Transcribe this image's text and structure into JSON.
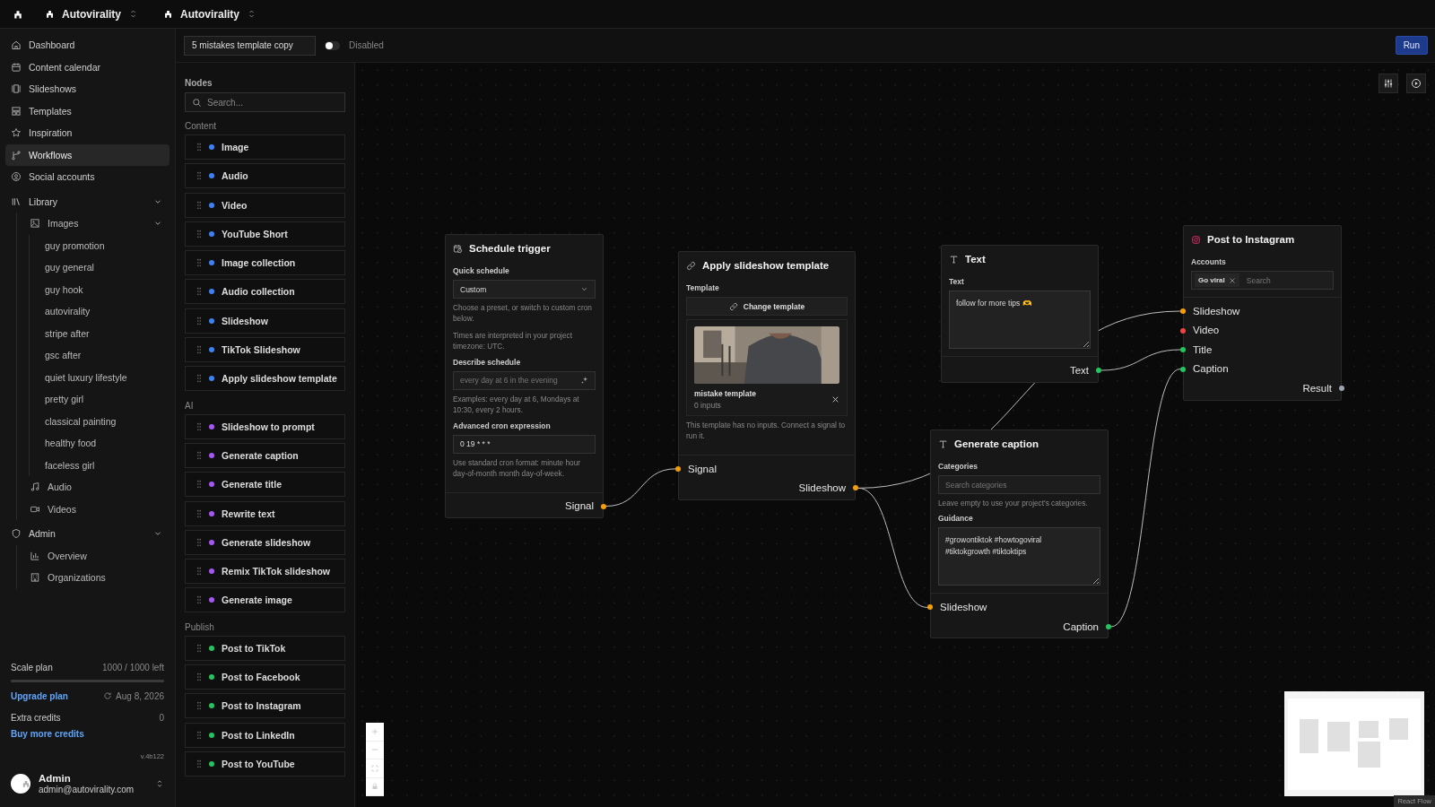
{
  "topbar": {
    "breadcrumbs": [
      {
        "label": "Autovirality"
      },
      {
        "label": "Autovirality"
      }
    ]
  },
  "sidebar": {
    "items": [
      {
        "label": "Dashboard",
        "selected": false
      },
      {
        "label": "Content calendar",
        "selected": false
      },
      {
        "label": "Slideshows",
        "selected": false
      },
      {
        "label": "Templates",
        "selected": false
      },
      {
        "label": "Inspiration",
        "selected": false
      },
      {
        "label": "Workflows",
        "selected": true
      },
      {
        "label": "Social accounts",
        "selected": false
      },
      {
        "label": "Library",
        "selected": false,
        "expanded": true,
        "children": [
          {
            "label": "Images",
            "selected": false,
            "expanded": true,
            "children": [
              {
                "label": "guy promotion",
                "selected": false
              },
              {
                "label": "guy general",
                "selected": false
              },
              {
                "label": "guy hook",
                "selected": false
              },
              {
                "label": "autovirality",
                "selected": false
              },
              {
                "label": "stripe after",
                "selected": false
              },
              {
                "label": "gsc after",
                "selected": false
              },
              {
                "label": "quiet luxury lifestyle",
                "selected": false
              },
              {
                "label": "pretty girl",
                "selected": false
              },
              {
                "label": "classical painting",
                "selected": false
              },
              {
                "label": "healthy food",
                "selected": false
              },
              {
                "label": "faceless girl",
                "selected": false
              }
            ]
          },
          {
            "label": "Audio",
            "selected": false
          },
          {
            "label": "Videos",
            "selected": false
          }
        ]
      },
      {
        "label": "Admin",
        "selected": false,
        "expanded": true,
        "children": [
          {
            "label": "Overview",
            "selected": false
          },
          {
            "label": "Organizations",
            "selected": false
          }
        ]
      }
    ],
    "plan": {
      "name": "Scale plan",
      "credits": "1000 / 1000 left",
      "level": 1,
      "upgrade_link": "Upgrade plan",
      "renewal": "Aug 8, 2026",
      "extra_label": "Extra credits",
      "extra_value": "0",
      "buy_link": "Buy more credits"
    },
    "version": "v.4b122",
    "user": {
      "name": "Admin",
      "email": "admin@autovirality.com"
    }
  },
  "toolbar": {
    "workflow_name": "5 mistakes template copy",
    "enabled": false,
    "toggle_label": "Disabled",
    "run_button": "Run"
  },
  "node_library": {
    "title": "Nodes",
    "search": {
      "placeholder": "Search..."
    },
    "sections": [
      {
        "title": "Content",
        "items": [
          {
            "label": "Image",
            "color": "#3b82f6"
          },
          {
            "label": "Audio",
            "color": "#3b82f6"
          },
          {
            "label": "Video",
            "color": "#3b82f6"
          },
          {
            "label": "YouTube Short",
            "color": "#3b82f6"
          },
          {
            "label": "Image collection",
            "color": "#3b82f6"
          },
          {
            "label": "Audio collection",
            "color": "#3b82f6"
          },
          {
            "label": "Slideshow",
            "color": "#3b82f6"
          },
          {
            "label": "TikTok Slideshow",
            "color": "#3b82f6"
          },
          {
            "label": "Apply slideshow template",
            "color": "#3b82f6"
          }
        ]
      },
      {
        "title": "AI",
        "items": [
          {
            "label": "Slideshow to prompt",
            "color": "#a855f7"
          },
          {
            "label": "Generate caption",
            "color": "#a855f7"
          },
          {
            "label": "Generate title",
            "color": "#a855f7"
          },
          {
            "label": "Rewrite text",
            "color": "#a855f7"
          },
          {
            "label": "Generate slideshow",
            "color": "#a855f7"
          },
          {
            "label": "Remix TikTok slideshow",
            "color": "#a855f7"
          },
          {
            "label": "Generate image",
            "color": "#a855f7"
          }
        ]
      },
      {
        "title": "Publish",
        "items": [
          {
            "label": "Post to TikTok",
            "color": "#22c55e"
          },
          {
            "label": "Post to Facebook",
            "color": "#22c55e"
          },
          {
            "label": "Post to Instagram",
            "color": "#22c55e"
          },
          {
            "label": "Post to LinkedIn",
            "color": "#22c55e"
          },
          {
            "label": "Post to YouTube",
            "color": "#22c55e"
          }
        ]
      }
    ]
  },
  "canvas": {
    "nodes": [
      {
        "kind": "trigger",
        "title": "Schedule trigger",
        "fields": [
          {
            "kind": "select",
            "label": "Quick schedule",
            "value": "Custom"
          },
          {
            "kind": "note",
            "text": "Choose a preset, or switch to custom cron below."
          },
          {
            "kind": "note",
            "text": "Times are interpreted in your project timezone: UTC."
          },
          {
            "kind": "prompt-input",
            "label": "Describe schedule",
            "placeholder": "every day at 6 in the evening"
          },
          {
            "kind": "note",
            "text": "Examples: every day at 6, Mondays at 10:30, every 2 hours."
          },
          {
            "kind": "input",
            "label": "Advanced cron expression",
            "value": "0 19 * * *"
          },
          {
            "kind": "note",
            "text": "Use standard cron format: minute hour day-of-month month day-of-week."
          }
        ],
        "outputs": [
          {
            "label": "Signal",
            "color": "#f59e0b"
          }
        ]
      },
      {
        "kind": "template",
        "title": "Apply slideshow template",
        "fields": [
          {
            "kind": "button",
            "label": "Template",
            "button": "Change template"
          },
          {
            "kind": "template",
            "name": "mistake template",
            "meta": "0 inputs"
          },
          {
            "kind": "note",
            "text": "This template has no inputs. Connect a signal to run it."
          }
        ],
        "inputs": [
          {
            "label": "Signal",
            "color": "#f59e0b"
          }
        ],
        "outputs": [
          {
            "label": "Slideshow",
            "color": "#f59e0b"
          }
        ]
      },
      {
        "kind": "text",
        "title": "Text",
        "fields": [
          {
            "kind": "textarea",
            "label": "Text",
            "value": "follow for more tips 🫶"
          }
        ],
        "outputs": [
          {
            "label": "Text",
            "color": "#22c55e"
          }
        ]
      },
      {
        "kind": "publish",
        "title": "Post to Instagram",
        "fields": [
          {
            "kind": "tags",
            "label": "Accounts",
            "tags": [
              {
                "label": "Go viral"
              }
            ],
            "placeholder": "Search"
          }
        ],
        "inputs": [
          {
            "label": "Slideshow",
            "color": "#f59e0b"
          },
          {
            "label": "Video",
            "color": "#ef4444"
          },
          {
            "label": "Title",
            "color": "#22c55e"
          },
          {
            "label": "Caption",
            "color": "#22c55e"
          }
        ],
        "outputs": [
          {
            "label": "Result",
            "color": "#9ca3af"
          }
        ]
      },
      {
        "kind": "text",
        "title": "Generate caption",
        "fields": [
          {
            "kind": "input",
            "label": "Categories",
            "placeholder": "Search categories"
          },
          {
            "kind": "note",
            "text": "Leave empty to use your project's categories."
          },
          {
            "kind": "textarea",
            "label": "Guidance",
            "value": "#growontiktok #howtogoviral\n#tiktokgrowth #tiktoktips"
          }
        ],
        "inputs": [
          {
            "label": "Slideshow",
            "color": "#f59e0b"
          }
        ],
        "outputs": [
          {
            "label": "Caption",
            "color": "#22c55e"
          }
        ]
      }
    ],
    "attribution": "React Flow"
  }
}
